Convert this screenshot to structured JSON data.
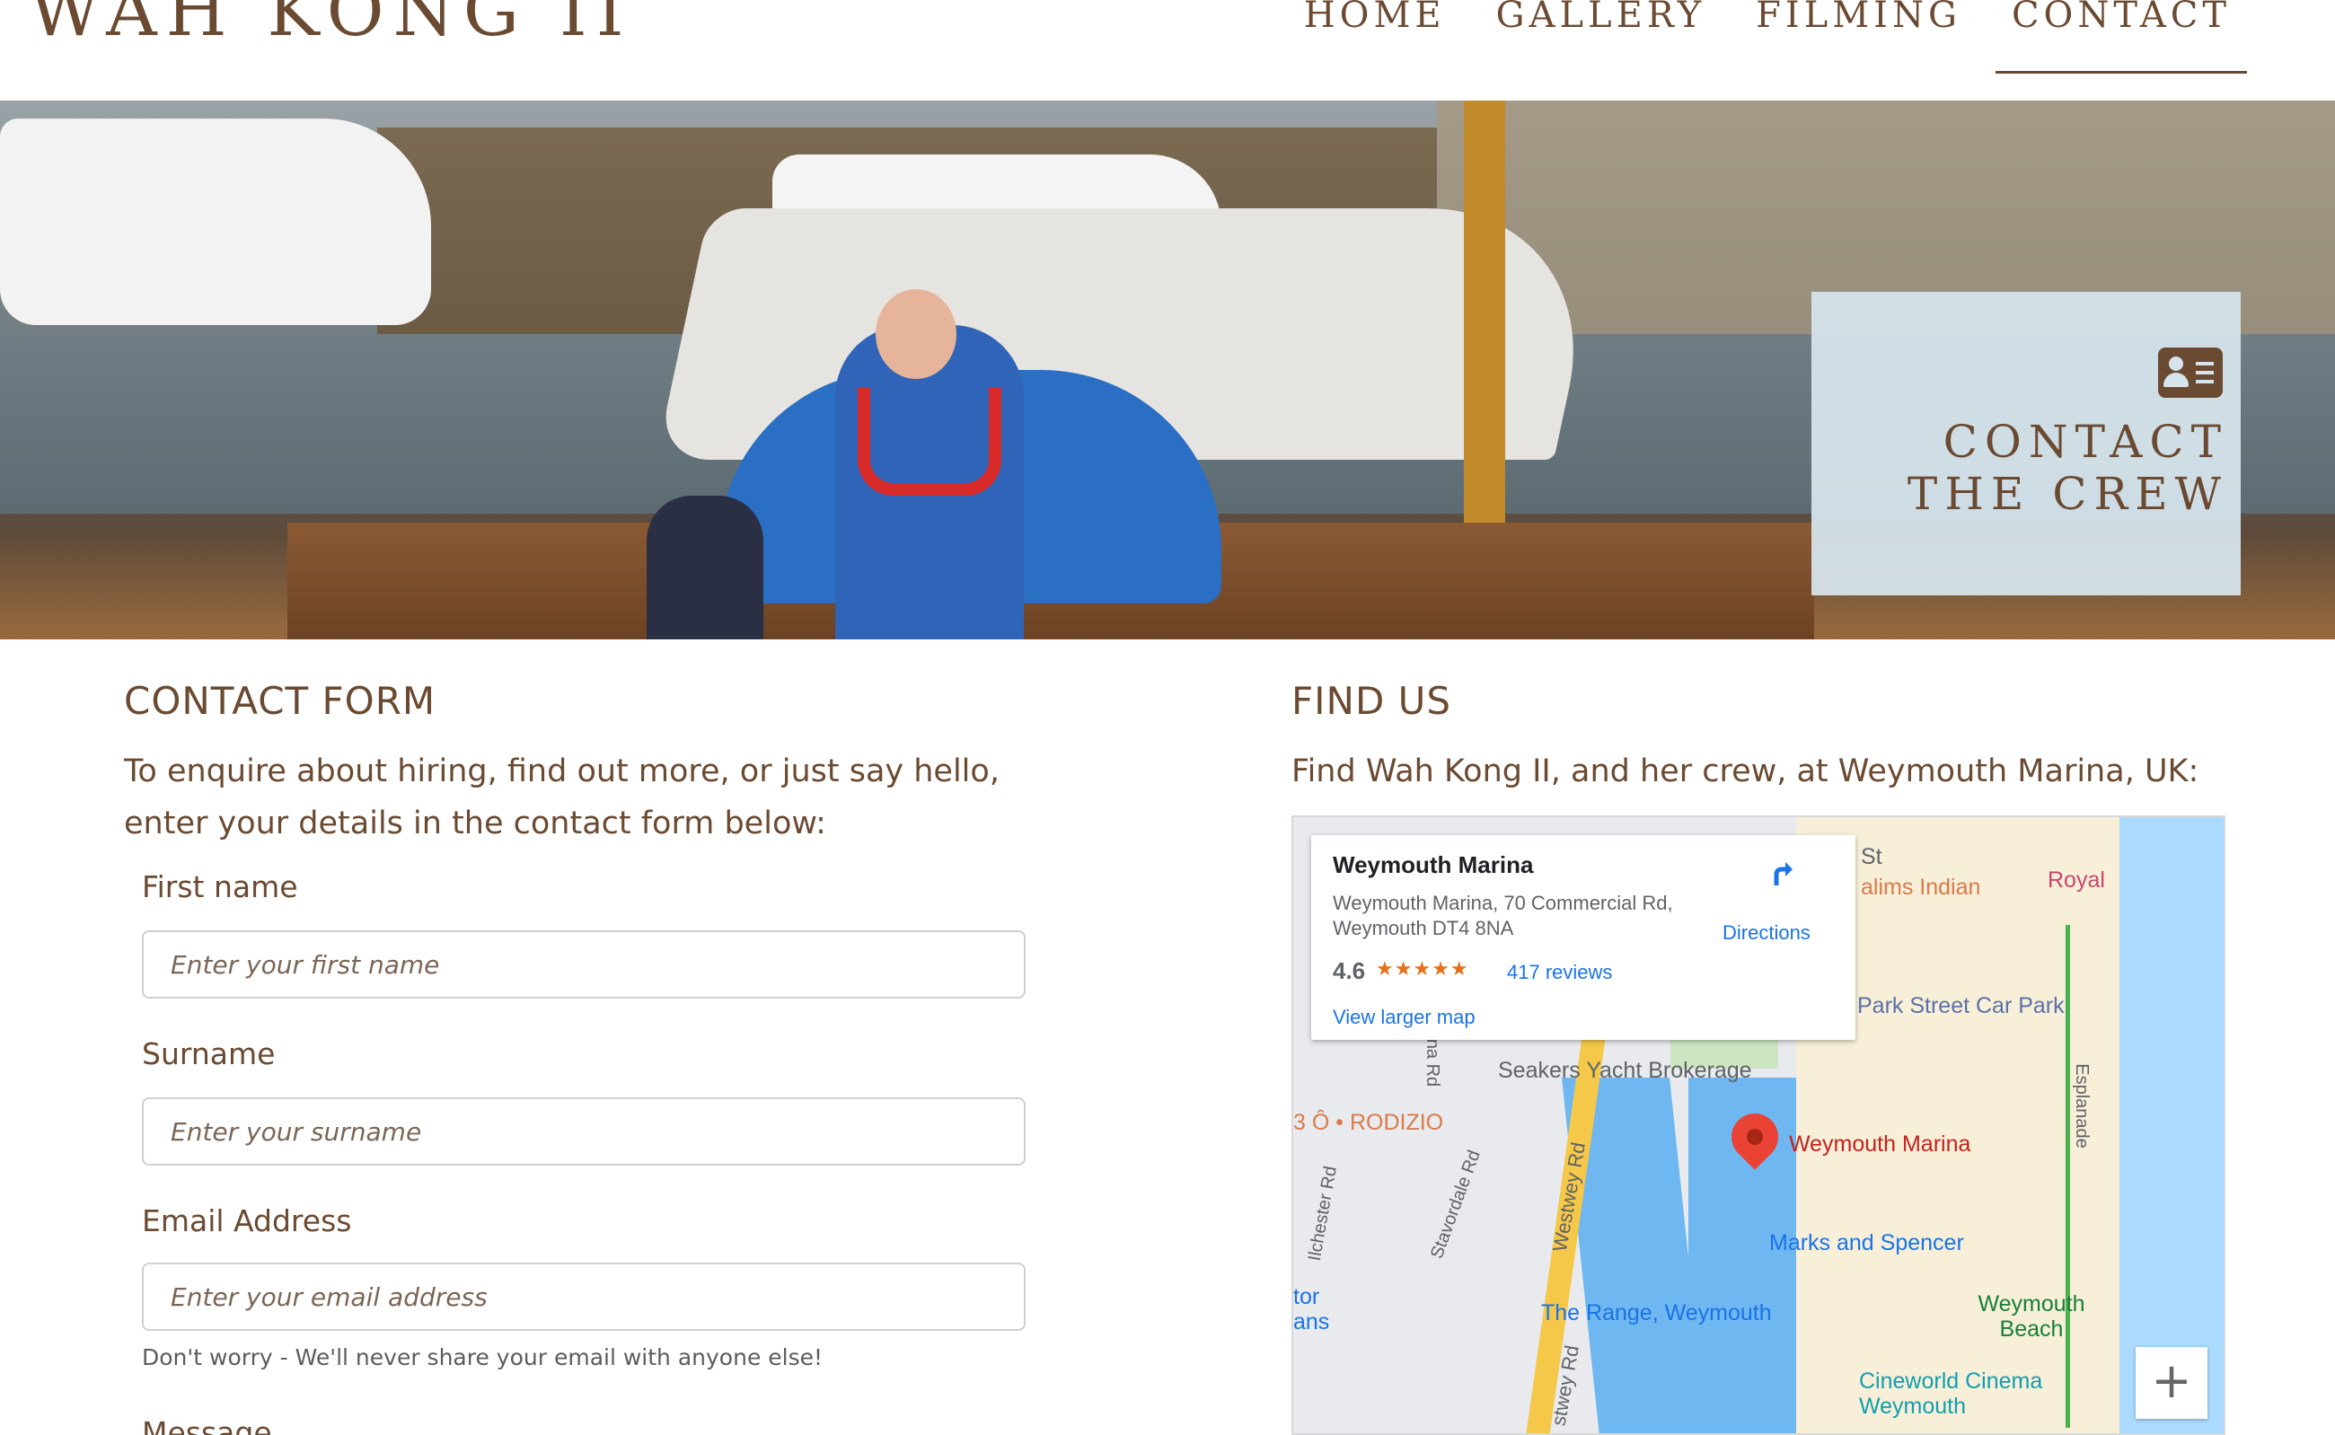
{
  "header": {
    "brand": "WAH KONG II",
    "nav": [
      "HOME",
      "GALLERY",
      "FILMING",
      "CONTACT"
    ]
  },
  "hero": {
    "contact_title": "CONTACT THE CREW",
    "icon": "address-card-icon"
  },
  "contact_form": {
    "title": "CONTACT FORM",
    "lead": "To enquire about hiring, find out more, or just say hello, enter your details in the contact form below:",
    "fields": [
      {
        "label": "First name",
        "placeholder": "Enter your first name"
      },
      {
        "label": "Surname",
        "placeholder": "Enter your surname"
      },
      {
        "label": "Email Address",
        "placeholder": "Enter your email address"
      }
    ],
    "email_help": "Don't worry - We'll never share your email with anyone else!",
    "message_label": "Message"
  },
  "find_us": {
    "title": "FIND US",
    "lead": "Find Wah Kong II, and her crew, at Weymouth Marina, UK:",
    "map": {
      "place_name": "Weymouth Marina",
      "address": "Weymouth Marina, 70 Commercial Rd, Weymouth DT4 8NA",
      "rating": "4.6",
      "stars": "★★★★★",
      "reviews": "417 reviews",
      "view_larger": "View larger map",
      "directions": "Directions",
      "labels": {
        "st": "St",
        "salims": "alims Indian",
        "royal": "Royal",
        "park_street": "Park Street Car Park",
        "seakers": "Seakers Yacht Brokerage",
        "rodizio": "3 Ô • RODIZIO",
        "na_rd": "na Rd",
        "westwey": "Westwey Rd",
        "stavordale": "Stavordale Rd",
        "ilchester": "Ilchester Rd",
        "esplanade": "Esplanade",
        "marina_pin": "Weymouth Marina",
        "marks": "Marks and Spencer",
        "range": "The Range, Weymouth",
        "beach": "Weymouth Beach",
        "cineworld": "Cineworld Cinema Weymouth",
        "tor": "tor",
        "ans": "ans",
        "stwey": "stwey Rd"
      },
      "zoom_in": "+"
    }
  }
}
